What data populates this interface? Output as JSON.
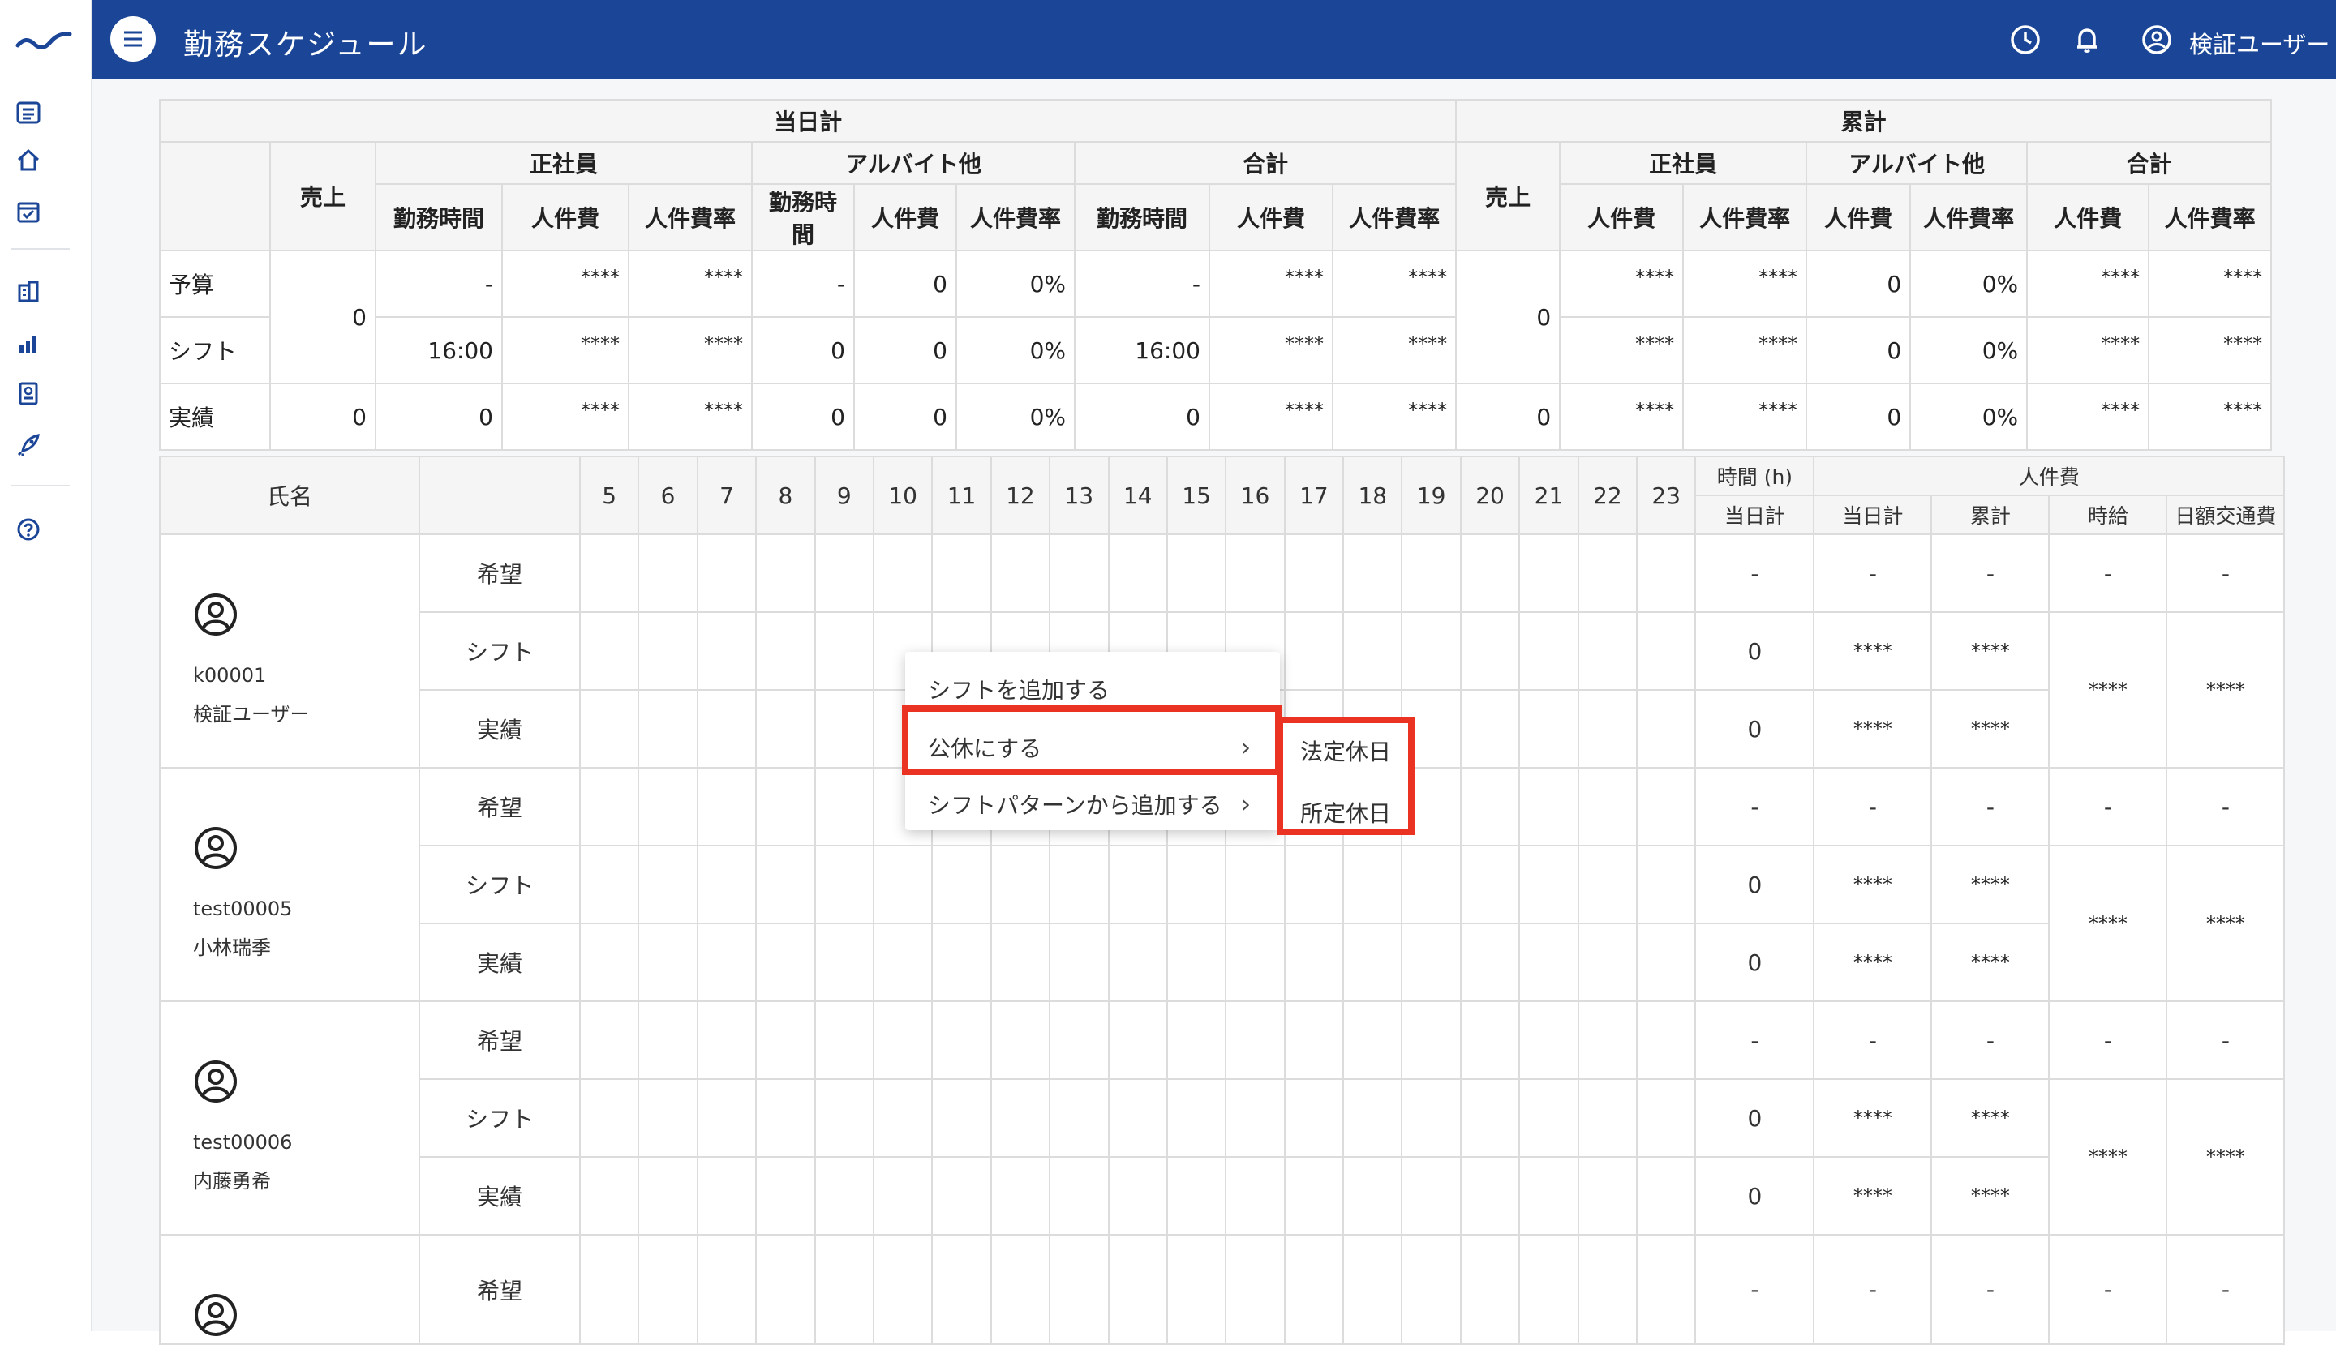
{
  "header": {
    "title": "勤務スケジュール",
    "user_name": "検証ユーザー"
  },
  "sidebar": {
    "icons": [
      "logo-wave",
      "list-icon",
      "home-icon",
      "calendar-check-icon",
      "building-icon",
      "bar-chart-icon",
      "id-card-icon",
      "rocket-icon",
      "help-icon"
    ]
  },
  "summary": {
    "group_today": "当日計",
    "group_cumulative": "累計",
    "sales": "売上",
    "regular": "正社員",
    "parttime": "アルバイト他",
    "total": "合計",
    "work_hours": "勤務時間",
    "labor_cost": "人件費",
    "labor_rate": "人件費率",
    "rows": [
      {
        "label": "予算",
        "today": [
          "-",
          "****",
          "****",
          "-",
          "0",
          "0%",
          "-",
          "****",
          "****"
        ],
        "cumul": [
          "****",
          "****",
          "0",
          "0%",
          "****",
          "****"
        ]
      },
      {
        "label": "シフト",
        "today": [
          "16:00",
          "****",
          "****",
          "0",
          "0",
          "0%",
          "16:00",
          "****",
          "****"
        ],
        "cumul": [
          "****",
          "****",
          "0",
          "0%",
          "****",
          "****"
        ]
      },
      {
        "label": "実績",
        "sales_today": "0",
        "today": [
          "0",
          "****",
          "****",
          "0",
          "0",
          "0%",
          "0",
          "****",
          "****"
        ],
        "sales_cumul": "0",
        "cumul": [
          "****",
          "****",
          "0",
          "0%",
          "****",
          "****"
        ]
      }
    ],
    "sales_today_merged": "0",
    "sales_cumul_merged": "0"
  },
  "grid": {
    "name_header": "氏名",
    "hours": [
      "5",
      "6",
      "7",
      "8",
      "9",
      "10",
      "11",
      "12",
      "13",
      "14",
      "15",
      "16",
      "17",
      "18",
      "19",
      "20",
      "21",
      "22",
      "23"
    ],
    "time_header": "時間 (h)",
    "time_sub": "当日計",
    "cost_header": "人件費",
    "cost_subs": [
      "当日計",
      "累計",
      "時給",
      "日額交通費"
    ],
    "categories": [
      "希望",
      "シフト",
      "実績"
    ],
    "employees": [
      {
        "code": "k00001",
        "name": "検証ユーザー",
        "wish": [
          "-",
          "-",
          "-",
          "-",
          "-"
        ],
        "shift": [
          "0",
          "****",
          "****"
        ],
        "actual": [
          "0",
          "****",
          "****"
        ],
        "hourly": "****",
        "transport": "****"
      },
      {
        "code": "test00005",
        "name": "小林瑞季",
        "wish": [
          "-",
          "-",
          "-",
          "-",
          "-"
        ],
        "shift": [
          "0",
          "****",
          "****"
        ],
        "actual": [
          "0",
          "****",
          "****"
        ],
        "hourly": "****",
        "transport": "****"
      },
      {
        "code": "test00006",
        "name": "内藤勇希",
        "wish": [
          "-",
          "-",
          "-",
          "-",
          "-"
        ],
        "shift": [
          "0",
          "****",
          "****"
        ],
        "actual": [
          "0",
          "****",
          "****"
        ],
        "hourly": "****",
        "transport": "****"
      },
      {
        "code": "",
        "name": "",
        "wish": [
          "-",
          "-",
          "-",
          "-",
          "-"
        ]
      }
    ]
  },
  "context_menu": {
    "items": [
      "シフトを追加する",
      "公休にする",
      "シフトパターンから追加する"
    ],
    "chevron": "›",
    "submenu": [
      "法定休日",
      "所定休日"
    ]
  },
  "colors": {
    "header_bg": "#1b4597",
    "highlight": "#ea3323"
  }
}
